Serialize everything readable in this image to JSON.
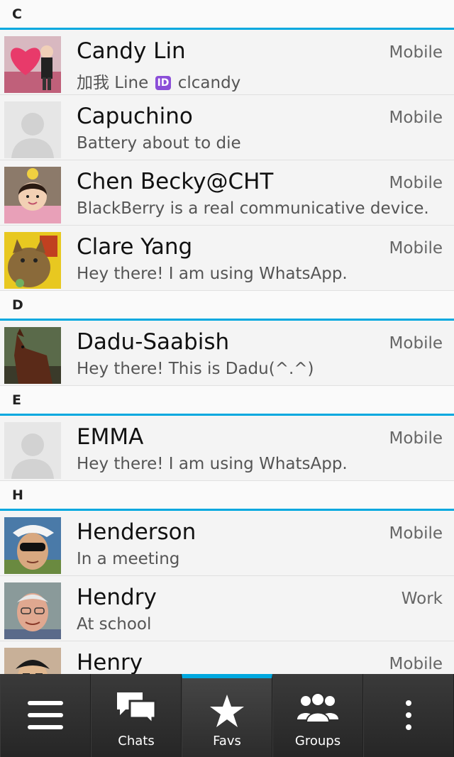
{
  "contacts_list": {
    "sections": [
      {
        "letter": "C",
        "contacts": [
          {
            "name": "Candy Lin",
            "status_prefix": "加我 Line",
            "status_badge": "ID",
            "status_suffix": "clcandy",
            "type": "Mobile",
            "avatar": "photo-heart"
          },
          {
            "name": "Capuchino",
            "status": "Battery about to die",
            "type": "Mobile",
            "avatar": "default-silhouette"
          },
          {
            "name": "Chen Becky@CHT",
            "status": "BlackBerry is a real communicative device.",
            "type": "Mobile",
            "avatar": "photo-child"
          },
          {
            "name": "Clare Yang",
            "status": "Hey there! I am using WhatsApp.",
            "type": "Mobile",
            "avatar": "photo-cat"
          }
        ]
      },
      {
        "letter": "D",
        "contacts": [
          {
            "name": "Dadu-Saabish",
            "status": "Hey there! This is Dadu(^.^)",
            "type": "Mobile",
            "avatar": "photo-dog"
          }
        ]
      },
      {
        "letter": "E",
        "contacts": [
          {
            "name": "EMMA",
            "status": "Hey there! I am using WhatsApp.",
            "type": "Mobile",
            "avatar": "default-silhouette"
          }
        ]
      },
      {
        "letter": "H",
        "contacts": [
          {
            "name": "Henderson",
            "status": "In a meeting",
            "type": "Mobile",
            "avatar": "photo-man-visor"
          },
          {
            "name": "Hendry",
            "status": "At school",
            "type": "Work",
            "avatar": "photo-older-man"
          },
          {
            "name": "Henry",
            "status": "",
            "type": "Mobile",
            "avatar": "photo-young-man"
          }
        ]
      }
    ]
  },
  "tabbar": {
    "menu_icon": "hamburger-icon",
    "tabs": [
      {
        "label": "Chats",
        "icon": "chat-bubbles-icon",
        "active": false
      },
      {
        "label": "Favs",
        "icon": "star-icon",
        "active": true
      },
      {
        "label": "Groups",
        "icon": "groups-icon",
        "active": false
      }
    ],
    "overflow_icon": "more-vertical-icon"
  },
  "colors": {
    "accent": "#00a8df",
    "badge": "#8b4ed8",
    "tabbar": "#2e2e2e"
  }
}
